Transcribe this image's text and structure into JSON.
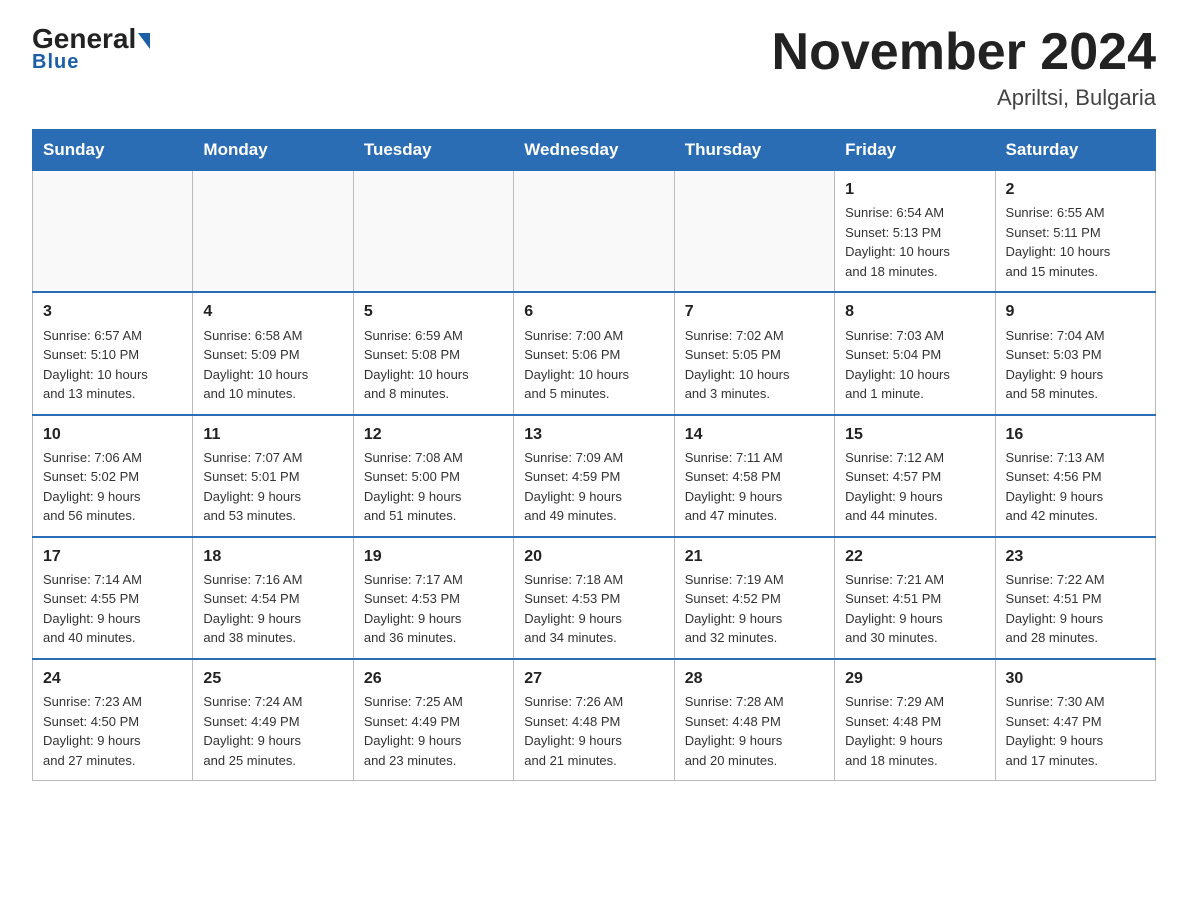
{
  "header": {
    "logo_general": "General",
    "logo_blue": "Blue",
    "month_title": "November 2024",
    "location": "Apriltsi, Bulgaria"
  },
  "weekdays": [
    "Sunday",
    "Monday",
    "Tuesday",
    "Wednesday",
    "Thursday",
    "Friday",
    "Saturday"
  ],
  "weeks": [
    [
      {
        "day": "",
        "info": ""
      },
      {
        "day": "",
        "info": ""
      },
      {
        "day": "",
        "info": ""
      },
      {
        "day": "",
        "info": ""
      },
      {
        "day": "",
        "info": ""
      },
      {
        "day": "1",
        "info": "Sunrise: 6:54 AM\nSunset: 5:13 PM\nDaylight: 10 hours\nand 18 minutes."
      },
      {
        "day": "2",
        "info": "Sunrise: 6:55 AM\nSunset: 5:11 PM\nDaylight: 10 hours\nand 15 minutes."
      }
    ],
    [
      {
        "day": "3",
        "info": "Sunrise: 6:57 AM\nSunset: 5:10 PM\nDaylight: 10 hours\nand 13 minutes."
      },
      {
        "day": "4",
        "info": "Sunrise: 6:58 AM\nSunset: 5:09 PM\nDaylight: 10 hours\nand 10 minutes."
      },
      {
        "day": "5",
        "info": "Sunrise: 6:59 AM\nSunset: 5:08 PM\nDaylight: 10 hours\nand 8 minutes."
      },
      {
        "day": "6",
        "info": "Sunrise: 7:00 AM\nSunset: 5:06 PM\nDaylight: 10 hours\nand 5 minutes."
      },
      {
        "day": "7",
        "info": "Sunrise: 7:02 AM\nSunset: 5:05 PM\nDaylight: 10 hours\nand 3 minutes."
      },
      {
        "day": "8",
        "info": "Sunrise: 7:03 AM\nSunset: 5:04 PM\nDaylight: 10 hours\nand 1 minute."
      },
      {
        "day": "9",
        "info": "Sunrise: 7:04 AM\nSunset: 5:03 PM\nDaylight: 9 hours\nand 58 minutes."
      }
    ],
    [
      {
        "day": "10",
        "info": "Sunrise: 7:06 AM\nSunset: 5:02 PM\nDaylight: 9 hours\nand 56 minutes."
      },
      {
        "day": "11",
        "info": "Sunrise: 7:07 AM\nSunset: 5:01 PM\nDaylight: 9 hours\nand 53 minutes."
      },
      {
        "day": "12",
        "info": "Sunrise: 7:08 AM\nSunset: 5:00 PM\nDaylight: 9 hours\nand 51 minutes."
      },
      {
        "day": "13",
        "info": "Sunrise: 7:09 AM\nSunset: 4:59 PM\nDaylight: 9 hours\nand 49 minutes."
      },
      {
        "day": "14",
        "info": "Sunrise: 7:11 AM\nSunset: 4:58 PM\nDaylight: 9 hours\nand 47 minutes."
      },
      {
        "day": "15",
        "info": "Sunrise: 7:12 AM\nSunset: 4:57 PM\nDaylight: 9 hours\nand 44 minutes."
      },
      {
        "day": "16",
        "info": "Sunrise: 7:13 AM\nSunset: 4:56 PM\nDaylight: 9 hours\nand 42 minutes."
      }
    ],
    [
      {
        "day": "17",
        "info": "Sunrise: 7:14 AM\nSunset: 4:55 PM\nDaylight: 9 hours\nand 40 minutes."
      },
      {
        "day": "18",
        "info": "Sunrise: 7:16 AM\nSunset: 4:54 PM\nDaylight: 9 hours\nand 38 minutes."
      },
      {
        "day": "19",
        "info": "Sunrise: 7:17 AM\nSunset: 4:53 PM\nDaylight: 9 hours\nand 36 minutes."
      },
      {
        "day": "20",
        "info": "Sunrise: 7:18 AM\nSunset: 4:53 PM\nDaylight: 9 hours\nand 34 minutes."
      },
      {
        "day": "21",
        "info": "Sunrise: 7:19 AM\nSunset: 4:52 PM\nDaylight: 9 hours\nand 32 minutes."
      },
      {
        "day": "22",
        "info": "Sunrise: 7:21 AM\nSunset: 4:51 PM\nDaylight: 9 hours\nand 30 minutes."
      },
      {
        "day": "23",
        "info": "Sunrise: 7:22 AM\nSunset: 4:51 PM\nDaylight: 9 hours\nand 28 minutes."
      }
    ],
    [
      {
        "day": "24",
        "info": "Sunrise: 7:23 AM\nSunset: 4:50 PM\nDaylight: 9 hours\nand 27 minutes."
      },
      {
        "day": "25",
        "info": "Sunrise: 7:24 AM\nSunset: 4:49 PM\nDaylight: 9 hours\nand 25 minutes."
      },
      {
        "day": "26",
        "info": "Sunrise: 7:25 AM\nSunset: 4:49 PM\nDaylight: 9 hours\nand 23 minutes."
      },
      {
        "day": "27",
        "info": "Sunrise: 7:26 AM\nSunset: 4:48 PM\nDaylight: 9 hours\nand 21 minutes."
      },
      {
        "day": "28",
        "info": "Sunrise: 7:28 AM\nSunset: 4:48 PM\nDaylight: 9 hours\nand 20 minutes."
      },
      {
        "day": "29",
        "info": "Sunrise: 7:29 AM\nSunset: 4:48 PM\nDaylight: 9 hours\nand 18 minutes."
      },
      {
        "day": "30",
        "info": "Sunrise: 7:30 AM\nSunset: 4:47 PM\nDaylight: 9 hours\nand 17 minutes."
      }
    ]
  ]
}
